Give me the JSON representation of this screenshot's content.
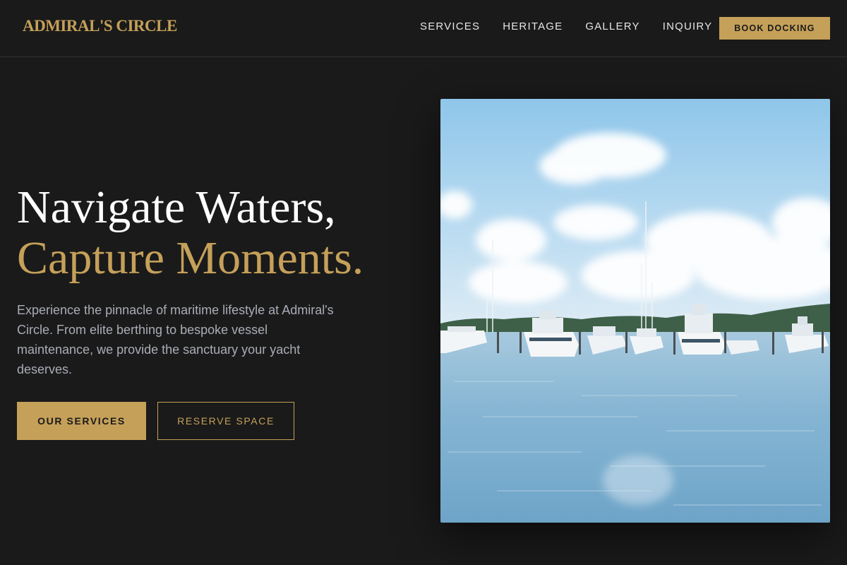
{
  "brand": {
    "logo_text": "ADMIRAL'S CIRCLE"
  },
  "nav": {
    "items": [
      {
        "label": "SERVICES"
      },
      {
        "label": "HERITAGE"
      },
      {
        "label": "GALLERY"
      },
      {
        "label": "INQUIRY"
      }
    ],
    "cta_label": "BOOK DOCKING"
  },
  "hero": {
    "title_line1": "Navigate Waters,",
    "title_line2": "Capture Moments.",
    "description": "Experience the pinnacle of maritime lifestyle at Admiral's Circle. From elite berthing to bespoke vessel maintenance, we provide the sanctuary your yacht deserves.",
    "primary_button": "OUR SERVICES",
    "secondary_button": "RESERVE SPACE"
  },
  "colors": {
    "background": "#1a1a1a",
    "accent_gold": "#c5a059",
    "text_white": "#ffffff",
    "text_muted": "#a9adb6"
  }
}
